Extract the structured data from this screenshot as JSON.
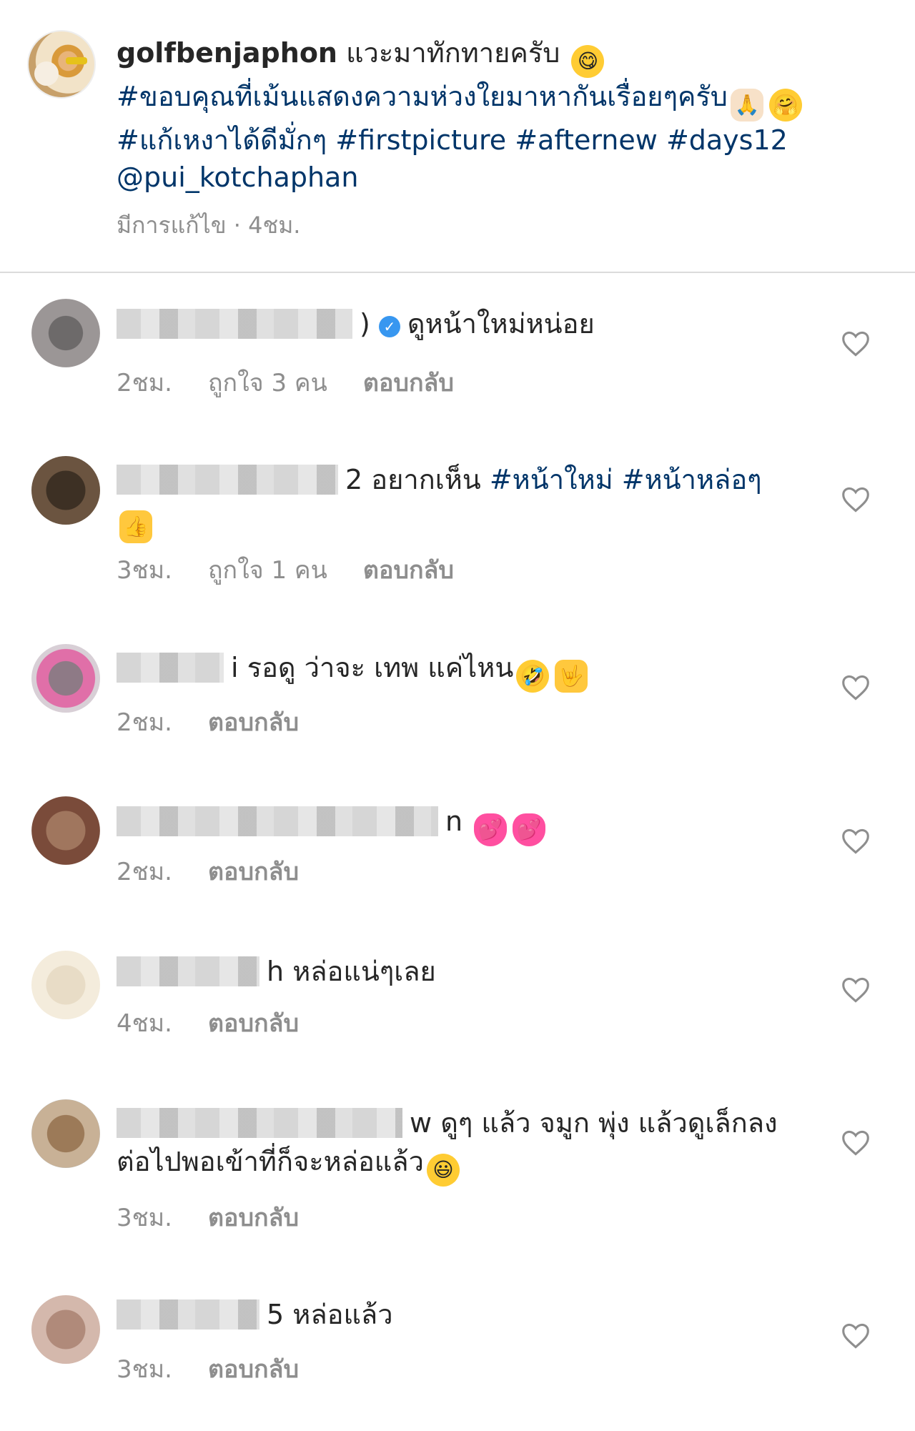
{
  "caption": {
    "username": "golfbenjaphon",
    "text1": " แวะมาทักทายครับ ",
    "tag1": "#ขอบคุณที่เม้นแสดงความห่วงใยมาหากันเรื่อยๆครับ",
    "tag2": "#แก้เหงาได้ดีมั่กๆ",
    "tag3": "#firstpicture",
    "tag4": "#afternew",
    "tag5": "#days12",
    "mention": "@pui_kotchaphan",
    "edited": "มีการแก้ไข · 4ชม.",
    "emoji_yum": "😋",
    "emoji_pray": "🙏",
    "emoji_hug": "🤗"
  },
  "comments": [
    {
      "name_tail": ")",
      "verified": "✓",
      "text": "ดูหน้าใหม่หน่อย",
      "time": "2ชม.",
      "likes": "ถูกใจ 3 คน",
      "reply": "ตอบกลับ"
    },
    {
      "name_tail": "2",
      "text": "อยากเห็น",
      "tag1": "#หน้าใหม่",
      "tag2": "#หน้าหล่อๆ",
      "emoji": "👍",
      "time": "3ชม.",
      "likes": "ถูกใจ 1 คน",
      "reply": "ตอบกลับ"
    },
    {
      "name_tail": "i",
      "text": "รอดู  ว่าจะ เทพ แค่ไหน",
      "emoji1": "🤣",
      "emoji2": "🤟",
      "time": "2ชม.",
      "reply": "ตอบกลับ"
    },
    {
      "name_tail": "n",
      "emoji1": "💕",
      "emoji2": "💕",
      "time": "2ชม.",
      "reply": "ตอบกลับ"
    },
    {
      "name_tail": "h",
      "text": "หล่อแน่ๆเลย",
      "time": "4ชม.",
      "reply": "ตอบกลับ"
    },
    {
      "name_tail": "w",
      "text1": "ดูๆ แล้ว จมูก พุ่ง แล้วดูเล็กลง",
      "text2": "ต่อไปพอเข้าที่ก็จะหล่อแล้ว",
      "emoji": "😃",
      "time": "3ชม.",
      "reply": "ตอบกลับ"
    },
    {
      "name_tail": "5",
      "text": "หล่อแล้ว",
      "time": "3ชม.",
      "reply": "ตอบกลับ"
    }
  ],
  "colors": {
    "hashtag": "#003569",
    "meta": "#8e8e8e",
    "verified": "#3897f0"
  }
}
